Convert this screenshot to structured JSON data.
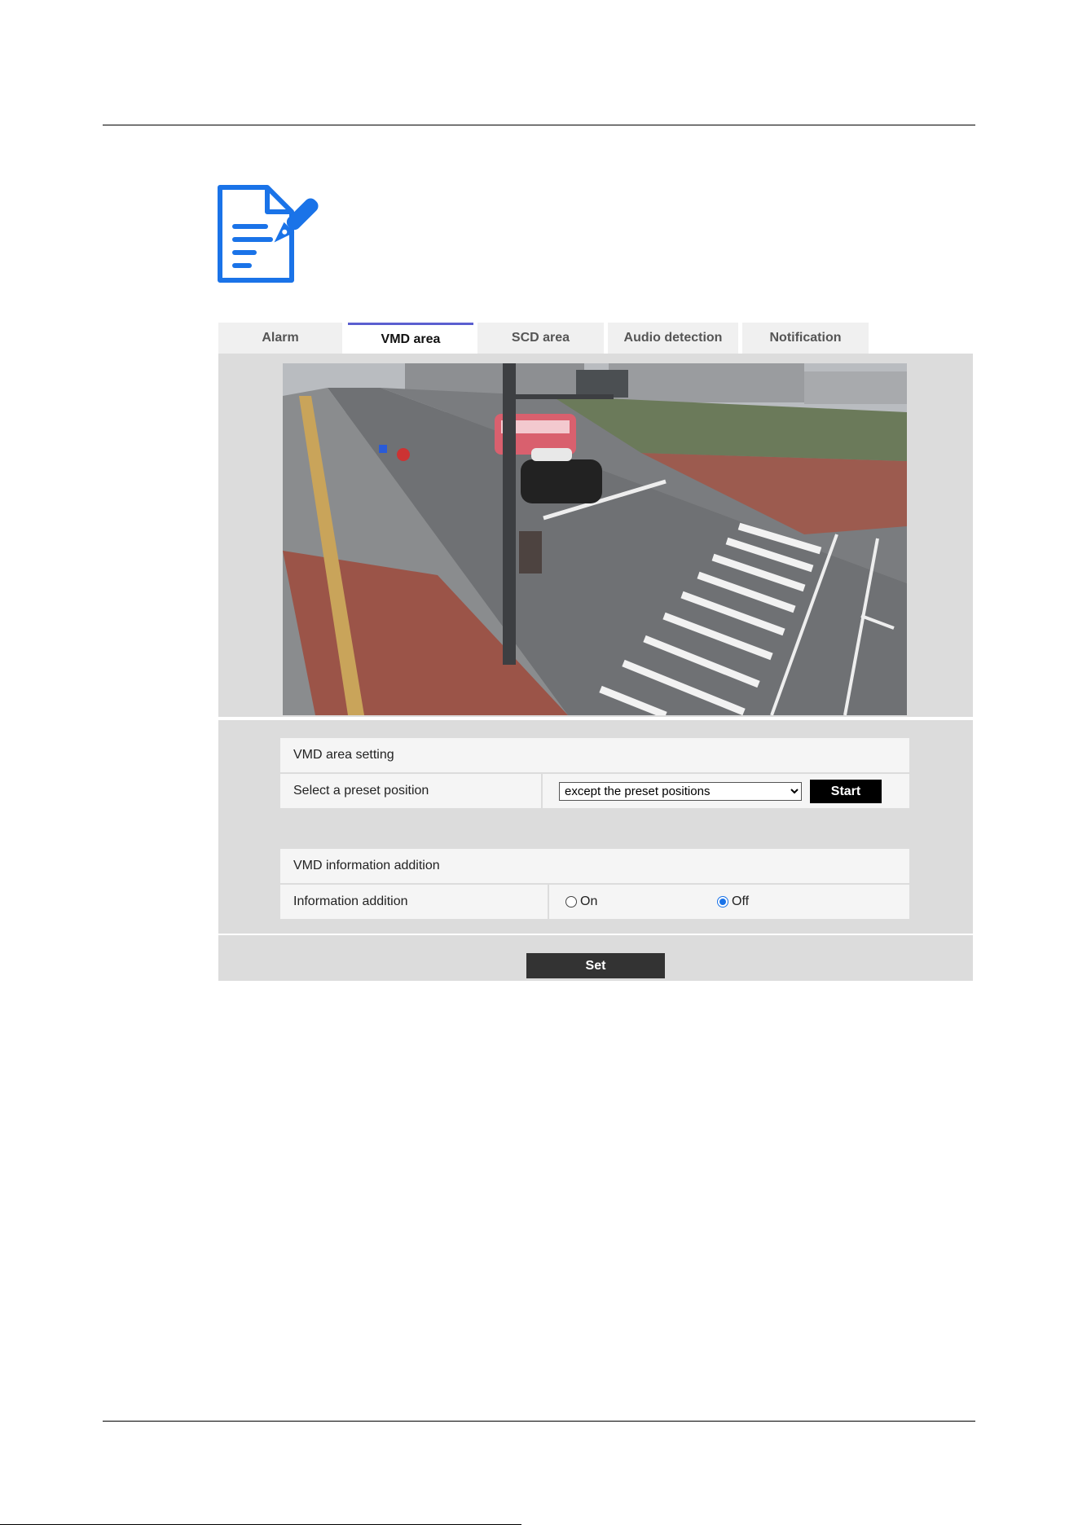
{
  "tabs": [
    {
      "label": "Alarm"
    },
    {
      "label": "VMD area"
    },
    {
      "label": "SCD area"
    },
    {
      "label": "Audio detection"
    },
    {
      "label": "Notification"
    }
  ],
  "active_tab": "VMD area",
  "vmd_area_setting": {
    "title": "VMD area setting",
    "preset_label": "Select a preset position",
    "preset_selected": "except the preset positions",
    "start_label": "Start"
  },
  "vmd_info_addition": {
    "title": "VMD information addition",
    "label": "Information addition",
    "option_on": "On",
    "option_off": "Off",
    "selected": "Off"
  },
  "set_label": "Set",
  "icons": {
    "note": "note-pen-icon"
  },
  "colors": {
    "accent": "#1a73e8",
    "active_tab_border": "#5b5fd0",
    "panel_bg": "#dcdcdc",
    "button_bg": "#000000"
  }
}
